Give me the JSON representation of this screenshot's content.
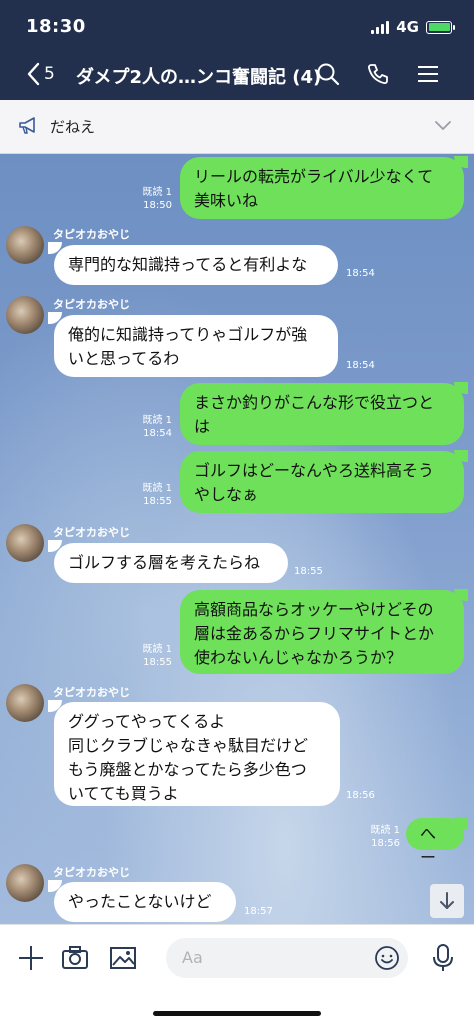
{
  "status": {
    "time": "18:30",
    "network": "4G"
  },
  "nav": {
    "back_count": "5",
    "title": "ダメプ2人の…ンコ奮闘記 (4)"
  },
  "announcement": {
    "text": "だねえ"
  },
  "messages": [
    {
      "side": "me",
      "lines": [
        "リールの転売がライバル少なくて",
        "美味いね"
      ],
      "read": "既読 1",
      "time": "18:50"
    },
    {
      "side": "other",
      "sender": "タピオカおやじ",
      "lines": [
        "専門的な知識持ってると有利よな"
      ],
      "time": "18:54"
    },
    {
      "side": "other",
      "sender": "タピオカおやじ",
      "lines": [
        "俺的に知識持ってりゃゴルフが強",
        "いと思ってるわ"
      ],
      "time": "18:54"
    },
    {
      "side": "me",
      "lines": [
        "まさか釣りがこんな形で役立つと",
        "は"
      ],
      "read": "既読 1",
      "time": "18:54"
    },
    {
      "side": "me",
      "lines": [
        "ゴルフはどーなんやろ送料高そう",
        "やしなぁ"
      ],
      "read": "既読 1",
      "time": "18:55"
    },
    {
      "side": "other",
      "sender": "タピオカおやじ",
      "lines": [
        "ゴルフする層を考えたらね"
      ],
      "time": "18:55"
    },
    {
      "side": "me",
      "lines": [
        "高額商品ならオッケーやけどその",
        "層は金あるからフリマサイトとか",
        "使わないんじゃなかろうか？"
      ],
      "read": "既読 1",
      "time": "18:55"
    },
    {
      "side": "other",
      "sender": "タピオカおやじ",
      "lines": [
        "ググってやってくるよ",
        "同じクラブじゃなきゃ駄目だけど",
        "もう廃盤とかなってたら多少色つ",
        "いてても買うよ"
      ],
      "time": "18:56"
    },
    {
      "side": "me",
      "lines": [
        "へー"
      ],
      "read": "既読 1",
      "time": "18:56"
    },
    {
      "side": "other",
      "sender": "タピオカおやじ",
      "lines": [
        "やったことないけど"
      ],
      "time": "18:57"
    }
  ],
  "input": {
    "placeholder": "Aa"
  },
  "colors": {
    "header": "#23304d",
    "my_bubble": "#6fe05a",
    "other_bubble": "#ffffff",
    "chat_bg": "#7e9ccc"
  }
}
